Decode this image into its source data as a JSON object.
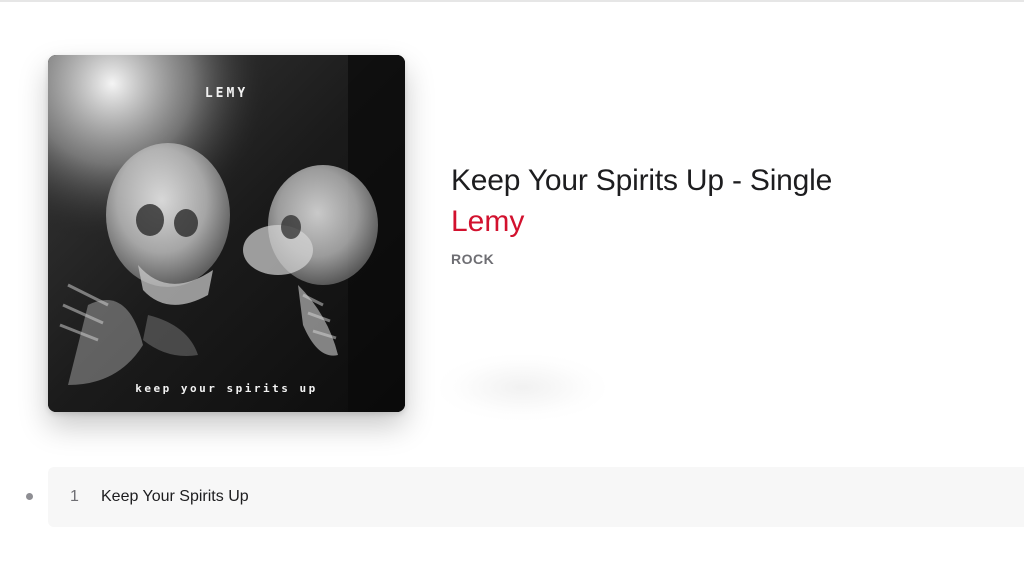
{
  "album": {
    "art_top_text": "LEMY",
    "art_bottom_text": "keep your spirits up",
    "title": "Keep Your Spirits Up - Single",
    "artist": "Lemy",
    "genre": "ROCK"
  },
  "tracks": [
    {
      "number": "1",
      "title": "Keep Your Spirits Up"
    }
  ],
  "colors": {
    "accent": "#d2112e",
    "title": "#1d1d1f",
    "secondary": "#6e6e73",
    "row_bg": "#f7f7f7"
  }
}
